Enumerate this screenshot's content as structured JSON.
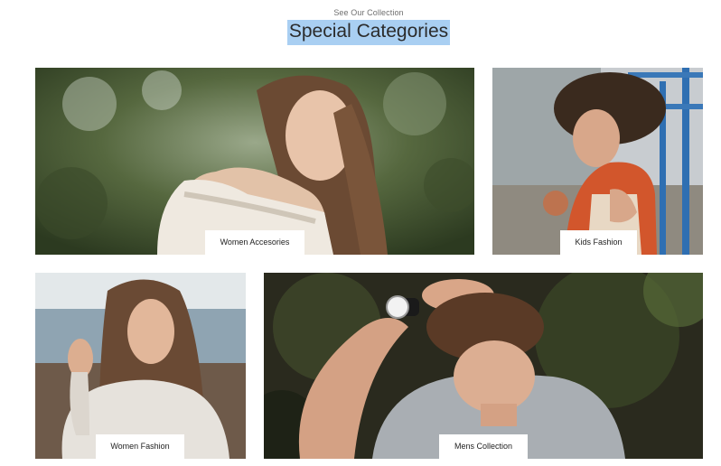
{
  "header": {
    "eyebrow": "See Our Collection",
    "title": "Special Categories"
  },
  "categories": [
    {
      "label": "Women Accesories"
    },
    {
      "label": "Kids Fashion"
    },
    {
      "label": "Women Fashion"
    },
    {
      "label": "Mens Collection"
    }
  ],
  "colors": {
    "title_highlight": "#a9cff2",
    "label_background": "#ffffff"
  }
}
